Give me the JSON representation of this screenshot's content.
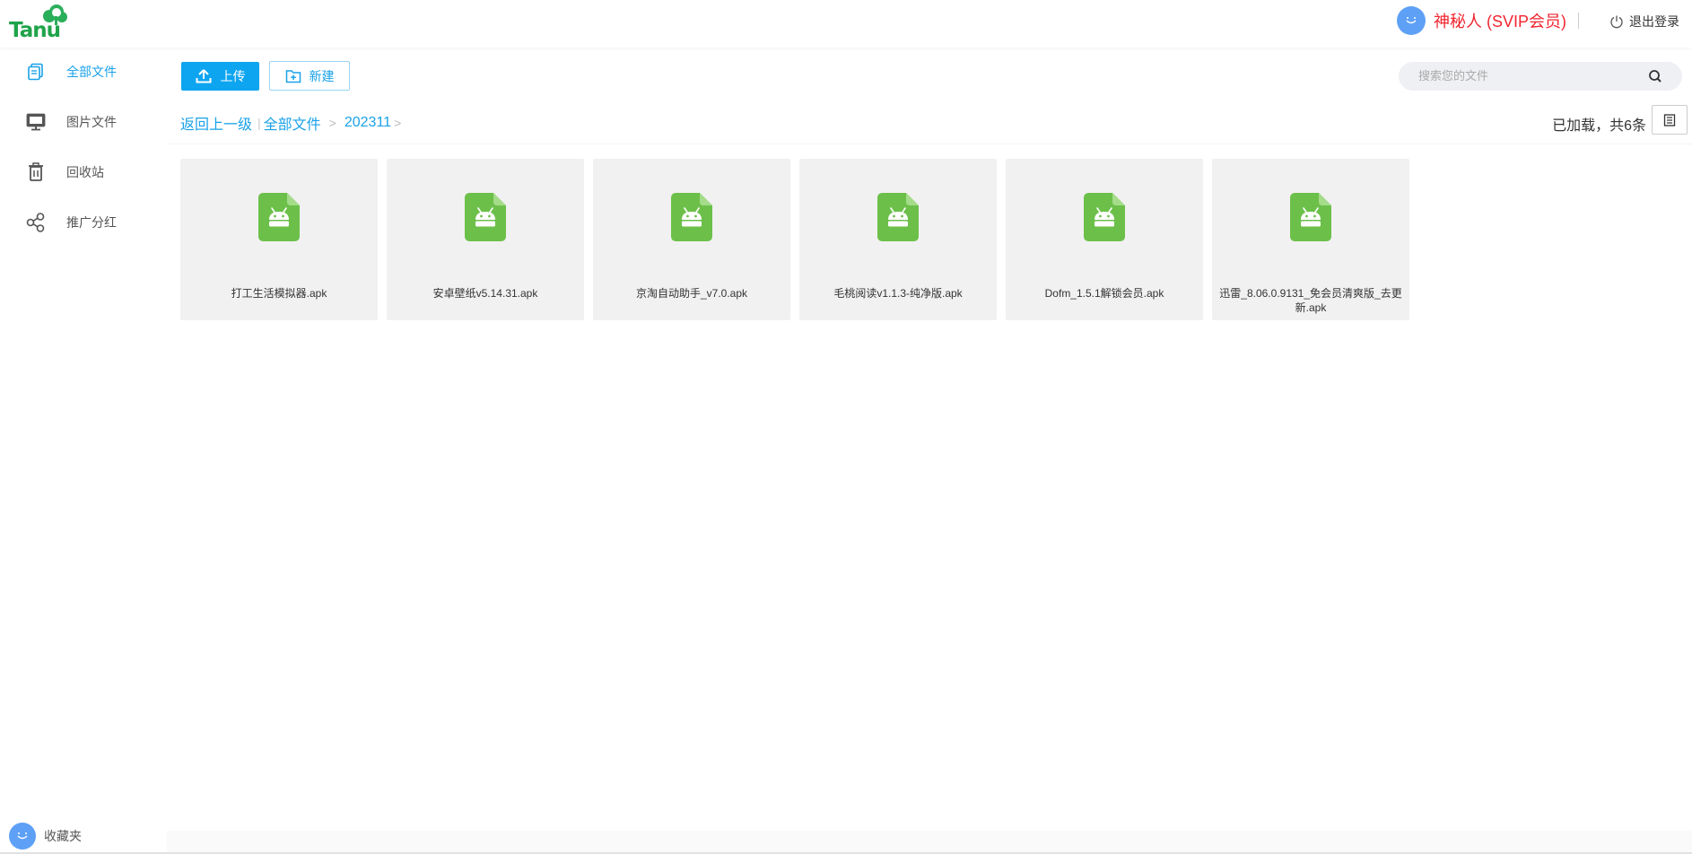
{
  "header": {
    "logo_text": "Tanu",
    "username": "神秘人 (SVIP会员)",
    "logout_label": "退出登录"
  },
  "sidebar": {
    "items": [
      {
        "label": "全部文件",
        "icon": "files-icon",
        "active": true
      },
      {
        "label": "图片文件",
        "icon": "monitor-icon",
        "active": false
      },
      {
        "label": "回收站",
        "icon": "trash-icon",
        "active": false
      },
      {
        "label": "推广分红",
        "icon": "share-icon",
        "active": false
      }
    ],
    "favorites_label": "收藏夹"
  },
  "toolbar": {
    "upload_label": "上传",
    "new_label": "新建",
    "search_placeholder": "搜索您的文件"
  },
  "breadcrumb": {
    "back_label": "返回上一级",
    "root_label": "全部文件",
    "current_label": "202311"
  },
  "status": {
    "count_text": "已加载，共6条"
  },
  "files": [
    {
      "name": "打工生活模拟器.apk",
      "type": "apk"
    },
    {
      "name": "安卓壁纸v5.14.31.apk",
      "type": "apk"
    },
    {
      "name": "京淘自动助手_v7.0.apk",
      "type": "apk"
    },
    {
      "name": "毛桃阅读v1.1.3-纯净版.apk",
      "type": "apk"
    },
    {
      "name": "Dofm_1.5.1解锁会员.apk",
      "type": "apk"
    },
    {
      "name": "迅雷_8.06.0.9131_免会员清爽版_去更新.apk",
      "type": "apk"
    }
  ],
  "colors": {
    "accent": "#0ea5f0",
    "vip_name": "#f0252f",
    "apk_icon": "#6cc04a",
    "logo": "#1fa34a"
  }
}
